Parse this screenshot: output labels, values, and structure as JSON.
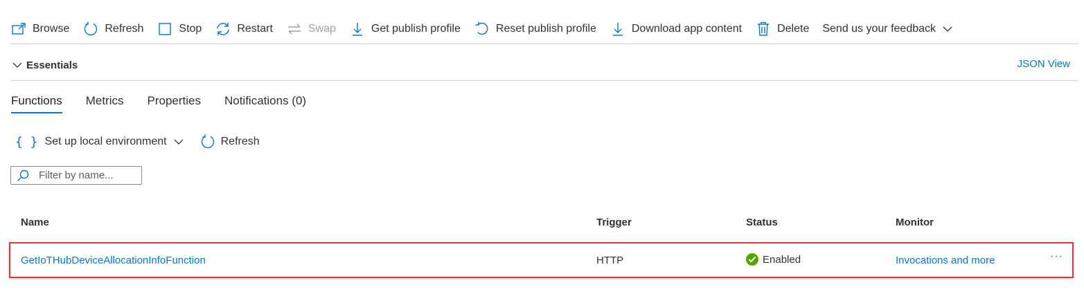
{
  "toolbar": {
    "browse": "Browse",
    "refresh": "Refresh",
    "stop": "Stop",
    "restart": "Restart",
    "swap": "Swap",
    "get_publish_profile": "Get publish profile",
    "reset_publish_profile": "Reset publish profile",
    "download_app_content": "Download app content",
    "delete": "Delete",
    "feedback": "Send us your feedback"
  },
  "essentials": {
    "label": "Essentials",
    "json_view": "JSON View"
  },
  "tabs": [
    {
      "label": "Functions",
      "active": true
    },
    {
      "label": "Metrics"
    },
    {
      "label": "Properties"
    },
    {
      "label": "Notifications (0)"
    }
  ],
  "subtoolbar": {
    "setup_local": "Set up local environment",
    "refresh": "Refresh"
  },
  "filter": {
    "placeholder": "Filter by name..."
  },
  "table": {
    "headers": {
      "name": "Name",
      "trigger": "Trigger",
      "status": "Status",
      "monitor": "Monitor"
    },
    "rows": [
      {
        "name": "GetIoTHubDeviceAllocationInfoFunction",
        "trigger": "HTTP",
        "status": "Enabled",
        "monitor": "Invocations and more",
        "more": "···"
      }
    ]
  },
  "colors": {
    "accent": "#0078d4",
    "status_ok": "#57a300",
    "highlight_border": "#e0373c"
  },
  "icons": [
    "browse-icon",
    "refresh-icon",
    "stop-icon",
    "restart-icon",
    "swap-icon",
    "download-icon",
    "reset-icon",
    "delete-icon",
    "chevron-down-icon",
    "braces-icon",
    "search-icon",
    "check-icon"
  ]
}
